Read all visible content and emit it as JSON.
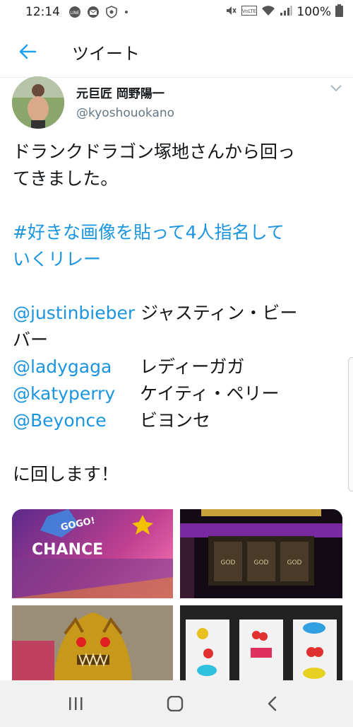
{
  "status_bar": {
    "time": "12:14",
    "battery": "100%",
    "notification_icons": [
      "line-icon",
      "mail-icon",
      "shield-icon",
      "dot-icon"
    ],
    "system_icons": [
      "mute-icon",
      "volte-icon",
      "wifi-icon",
      "signal-icon",
      "battery-icon"
    ]
  },
  "header": {
    "title": "ツイート"
  },
  "tweet": {
    "author_name": "元巨匠 岡野陽一",
    "author_handle": "@kyoshouokano",
    "text_line1": "ドランクドラゴン塚地さんから回っ",
    "text_line2": "てきました。",
    "hashtag_line1": "#好きな画像を貼って4人指名して",
    "hashtag_line2": "いくリレー",
    "mentions": [
      {
        "handle": "@justinbieber",
        "name": "ジャスティン・ビー"
      },
      {
        "handle": "@ladygaga",
        "name": "レディーガガ"
      },
      {
        "handle": "@katyperry",
        "name": "ケイティ・ペリー"
      },
      {
        "handle": "@Beyonce",
        "name": "ビヨンセ"
      }
    ],
    "mention_wrap": "バー",
    "closing": "に回します！"
  },
  "media": {
    "tile1_text1": "GOGO!",
    "tile1_text2": "CHANCE",
    "tile2_text": "GOD"
  },
  "colors": {
    "link": "#1b95e0",
    "text": "#14171a",
    "secondary": "#657786"
  }
}
